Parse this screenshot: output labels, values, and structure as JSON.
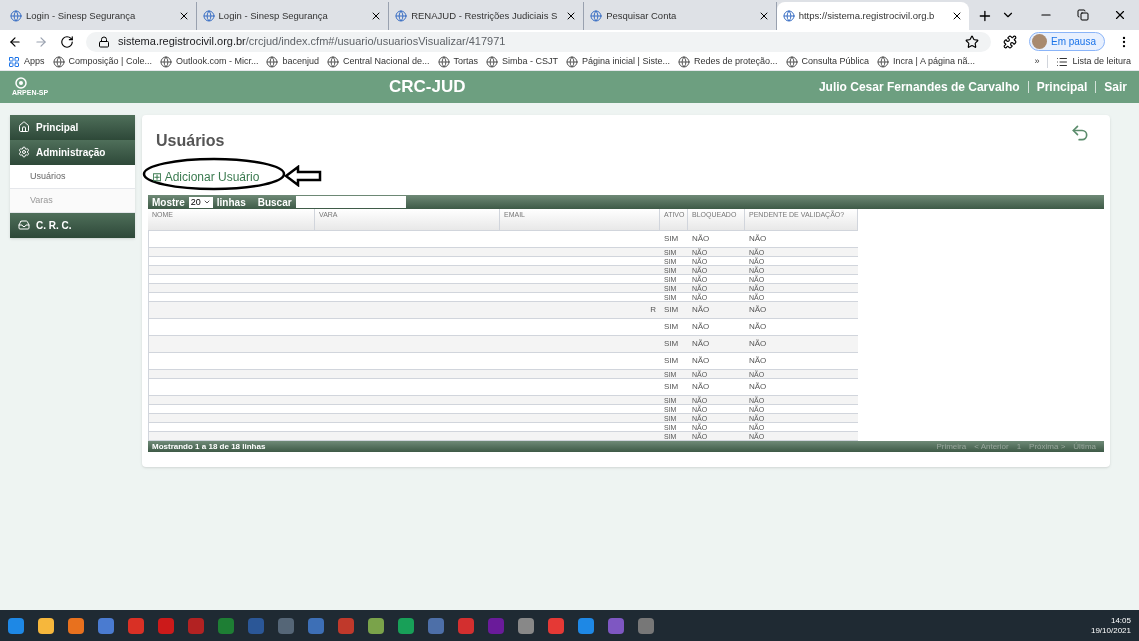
{
  "browser": {
    "tabs": [
      {
        "title": "Login - Sinesp Segurança",
        "selected": false
      },
      {
        "title": "Login - Sinesp Segurança",
        "selected": false
      },
      {
        "title": "RENAJUD - Restrições Judiciais S",
        "selected": false
      },
      {
        "title": "Pesquisar Conta",
        "selected": false
      },
      {
        "title": "https://sistema.registrocivil.org.b",
        "selected": true
      }
    ],
    "url_host": "sistema.registrocivil.org.br",
    "url_path": "/crcjud/index.cfm#/usuario/usuariosVisualizar/417971",
    "profile_label": "Em pausa",
    "bookmarks": [
      "Apps",
      "Composição | Cole...",
      "Outlook.com - Micr...",
      "bacenjud",
      "Central Nacional de...",
      "Tortas",
      "Simba - CSJT",
      "Página inicial | Siste...",
      "Redes de proteção...",
      "Consulta Pública",
      "Incra | A página nã..."
    ],
    "overflow": "»",
    "reading_list": "Lista de leitura"
  },
  "app": {
    "logo_caption": "ARPEN-SP",
    "title": "CRC-JUD",
    "user": "Julio Cesar Fernandes de Carvalho",
    "nav_links": [
      "Principal",
      "Sair"
    ]
  },
  "sidebar": {
    "items": [
      {
        "label": "Principal",
        "kind": "section",
        "selected": false
      },
      {
        "label": "Administração",
        "kind": "section",
        "selected": false
      },
      {
        "label": "Usuários",
        "kind": "sub",
        "selected": true
      },
      {
        "label": "Varas",
        "kind": "sub",
        "selected": false
      },
      {
        "label": "C. R. C.",
        "kind": "section",
        "selected": false
      }
    ]
  },
  "page": {
    "title": "Usuários",
    "add_link_icon": "⊞",
    "add_link": "Adicionar Usuário",
    "toolbar": {
      "show_label": "Mostre",
      "page_size": "20",
      "rows_label": "linhas",
      "search_label": "Buscar"
    },
    "table": {
      "columns": [
        {
          "label": "NOME"
        },
        {
          "label": "VARA"
        },
        {
          "label": "EMAIL"
        },
        {
          "label": "ATIVO"
        },
        {
          "label": "BLOQUEADO"
        },
        {
          "label": "PENDENTE DE VALIDAÇÃO?"
        }
      ],
      "rows": [
        {
          "kind": "tall",
          "email": "",
          "ativo": "SIM",
          "bloqueado": "NÃO",
          "pendente": "NÃO"
        },
        {
          "kind": "short",
          "ativo": "SIM",
          "bloqueado": "NÃO",
          "pendente": "NÃO"
        },
        {
          "kind": "short",
          "ativo": "SIM",
          "bloqueado": "NÃO",
          "pendente": "NÃO"
        },
        {
          "kind": "short",
          "ativo": "SIM",
          "bloqueado": "NÃO",
          "pendente": "NÃO"
        },
        {
          "kind": "short",
          "ativo": "SIM",
          "bloqueado": "NÃO",
          "pendente": "NÃO"
        },
        {
          "kind": "short",
          "ativo": "SIM",
          "bloqueado": "NÃO",
          "pendente": "NÃO"
        },
        {
          "kind": "short",
          "ativo": "SIM",
          "bloqueado": "NÃO",
          "pendente": "NÃO"
        },
        {
          "kind": "tall",
          "email": "R",
          "ativo": "SIM",
          "bloqueado": "NÃO",
          "pendente": "NÃO"
        },
        {
          "kind": "tall",
          "ativo": "SIM",
          "bloqueado": "NÃO",
          "pendente": "NÃO"
        },
        {
          "kind": "tall",
          "ativo": "SIM",
          "bloqueado": "NÃO",
          "pendente": "NÃO"
        },
        {
          "kind": "tall",
          "ativo": "SIM",
          "bloqueado": "NÃO",
          "pendente": "NÃO"
        },
        {
          "kind": "short",
          "ativo": "SIM",
          "bloqueado": "NÃO",
          "pendente": "NÃO"
        },
        {
          "kind": "tall",
          "ativo": "SIM",
          "bloqueado": "NÃO",
          "pendente": "NÃO"
        },
        {
          "kind": "short",
          "ativo": "SIM",
          "bloqueado": "NÃO",
          "pendente": "NÃO"
        },
        {
          "kind": "short",
          "ativo": "SIM",
          "bloqueado": "NÃO",
          "pendente": "NÃO"
        },
        {
          "kind": "short",
          "ativo": "SIM",
          "bloqueado": "NÃO",
          "pendente": "NÃO"
        },
        {
          "kind": "short",
          "ativo": "SIM",
          "bloqueado": "NÃO",
          "pendente": "NÃO"
        },
        {
          "kind": "short",
          "ativo": "SIM",
          "bloqueado": "NÃO",
          "pendente": "NÃO"
        }
      ]
    },
    "footer": {
      "info": "Mostrando 1 a 18 de 18 linhas",
      "pager": [
        "Primeira",
        "< Anterior",
        "1",
        "Próxima >",
        "Última"
      ]
    }
  },
  "taskbar": {
    "time": "14:05",
    "date": "19/10/2021"
  }
}
